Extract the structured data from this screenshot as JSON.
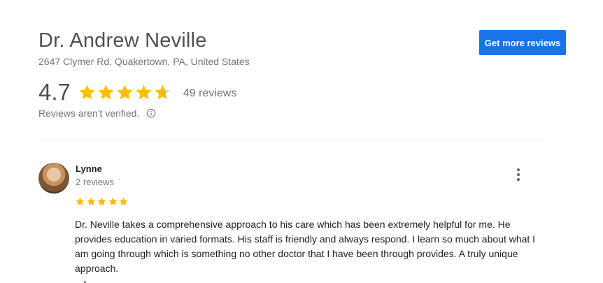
{
  "business": {
    "name": "Dr. Andrew Neville",
    "address": "2647 Clymer Rd, Quakertown, PA, United States",
    "rating": "4.7",
    "rating_value": 4.7,
    "review_count": "49 reviews",
    "verified_note": "Reviews aren't verified."
  },
  "actions": {
    "get_more_reviews": "Get more reviews"
  },
  "review": {
    "author": "Lynne",
    "author_reviews": "2 reviews",
    "stars": 5,
    "text": "Dr. Neville takes a comprehensive approach to his care which has been extremely helpful for me. He provides education in varied formats. His staff is friendly and always respond. I learn so much about what I am going through which is something no other doctor that I have been through provides. A truly unique approach."
  },
  "colors": {
    "star": "#fbbc04",
    "star_empty": "#dadce0",
    "accent": "#1a73e8"
  }
}
